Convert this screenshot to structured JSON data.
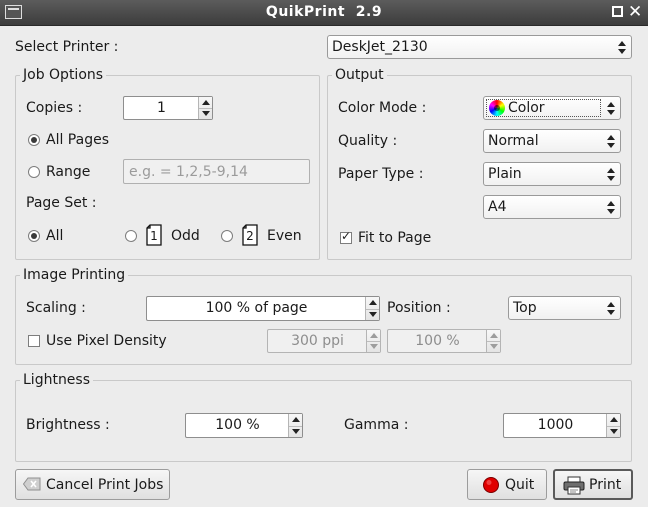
{
  "window": {
    "title": "QuikPrint  2.9"
  },
  "printer": {
    "label": "Select Printer :",
    "selected": "DeskJet_2130"
  },
  "job_options": {
    "title": "Job Options",
    "copies_label": "Copies :",
    "copies_value": "1",
    "all_pages_label": "All Pages",
    "range_label": "Range",
    "range_placeholder": "e.g. = 1,2,5-9,14",
    "page_set_label": "Page Set :",
    "page_set_all": "All",
    "page_set_odd": "Odd",
    "page_set_even": "Even",
    "odd_icon_number": "1",
    "even_icon_number": "2"
  },
  "output": {
    "title": "Output",
    "color_mode_label": "Color Mode :",
    "color_mode_value": "Color",
    "quality_label": "Quality :",
    "quality_value": "Normal",
    "paper_type_label": "Paper Type :",
    "paper_type_value": "Plain",
    "paper_size_value": "A4",
    "fit_to_page_label": "Fit to Page",
    "fit_to_page_checked": true
  },
  "image_printing": {
    "title": "Image Printing",
    "scaling_label": "Scaling :",
    "scaling_value": "100 % of page",
    "position_label": "Position :",
    "position_value": "Top",
    "pixel_density_label": "Use Pixel Density",
    "pixel_density_checked": false,
    "ppi_value": "300 ppi",
    "density_percent_value": "100 %"
  },
  "lightness": {
    "title": "Lightness",
    "brightness_label": "Brightness :",
    "brightness_value": "100 %",
    "gamma_label": "Gamma :",
    "gamma_value": "1000"
  },
  "buttons": {
    "cancel_jobs": "Cancel Print Jobs",
    "quit": "Quit",
    "print": "Print"
  },
  "colors": {
    "titlebar": "#444444",
    "window_bg": "#ececec",
    "quit_icon": "#e00000"
  },
  "icons": {
    "cancel_jobs": "backspace-icon",
    "quit": "red-stop-icon",
    "print": "printer-icon",
    "color_mode": "color-wheel-icon",
    "odd": "page-1-icon",
    "even": "page-2-icon"
  }
}
